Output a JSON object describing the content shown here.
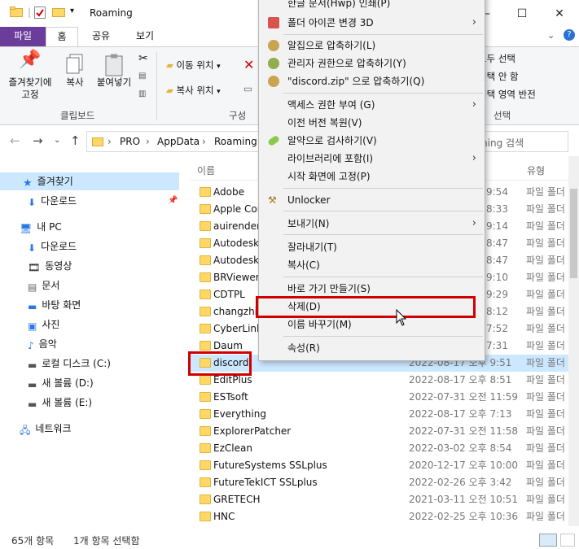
{
  "window": {
    "title": "Roaming",
    "minimize": "—",
    "maximize": "☐",
    "close": "✕"
  },
  "ribbon_tabs": [
    {
      "label": "파일"
    },
    {
      "label": "홈"
    },
    {
      "label": "공유"
    },
    {
      "label": "보기"
    }
  ],
  "ribbon": {
    "pin_label_1": "즐겨찾기에",
    "pin_label_2": "고정",
    "copy_label": "복사",
    "paste_label": "붙여넣기",
    "clipboard_group": "클립보드",
    "move_to": "이동 위치",
    "copy_to": "복사 위치",
    "organize_group": "구성",
    "select_all": "모두 선택",
    "select_none": "선택 안 함",
    "invert_select": "선택 영역 반전",
    "select_group": "선택"
  },
  "address": {
    "crumbs": [
      "PRO",
      "AppData",
      "Roaming"
    ],
    "search_placeholder": "ming 검색"
  },
  "nav": {
    "quick_access": "즐겨찾기",
    "downloads_pinned": "다운로드",
    "this_pc": "내 PC",
    "downloads": "다운로드",
    "videos": "동영상",
    "documents": "문서",
    "desktop": "바탕 화면",
    "pictures": "사진",
    "music": "음악",
    "local_disk": "로컬 디스크 (C:)",
    "volume_d": "새 볼륨 (D:)",
    "volume_e": "새 볼륨 (E:)",
    "network": "네트워크"
  },
  "columns": {
    "name": "이름",
    "type": "유형"
  },
  "files": [
    {
      "name": "Adobe",
      "date": "9:54",
      "type": "파일 폴더"
    },
    {
      "name": "Apple Con",
      "date": "8:33",
      "type": "파일 폴더"
    },
    {
      "name": "auirender",
      "date": "9:14",
      "type": "파일 폴더"
    },
    {
      "name": "Autodesk",
      "date": "8:47",
      "type": "파일 폴더"
    },
    {
      "name": "Autodesk",
      "date": "8:47",
      "type": "파일 폴더"
    },
    {
      "name": "BRViewer_",
      "date": "9:10",
      "type": "파일 폴더"
    },
    {
      "name": "CDTPL",
      "date": "9:29",
      "type": "파일 폴더"
    },
    {
      "name": "changzhi",
      "date": "8:12",
      "type": "파일 폴더"
    },
    {
      "name": "CyberLink",
      "date": "7:52",
      "type": "파일 폴더"
    },
    {
      "name": "Daum",
      "date": "7:31",
      "type": "파일 폴더"
    },
    {
      "name": "discord",
      "date": "2022-08-17 오후 9:51",
      "type": "파일 폴더"
    },
    {
      "name": "EditPlus",
      "date": "2022-08-17 오후 8:51",
      "type": "파일 폴더"
    },
    {
      "name": "ESTsoft",
      "date": "2022-07-31 오전 11:59",
      "type": "파일 폴더"
    },
    {
      "name": "Everything",
      "date": "2022-08-17 오후 7:13",
      "type": "파일 폴더"
    },
    {
      "name": "ExplorerPatcher",
      "date": "2022-07-31 오전 11:58",
      "type": "파일 폴더"
    },
    {
      "name": "EzClean",
      "date": "2022-03-02 오후 8:54",
      "type": "파일 폴더"
    },
    {
      "name": "FutureSystems SSLplus",
      "date": "2020-12-17 오후 10:00",
      "type": "파일 폴더"
    },
    {
      "name": "FutureTekICT SSLplus",
      "date": "2022-02-26 오후 3:42",
      "type": "파일 폴더"
    },
    {
      "name": "GRETECH",
      "date": "2021-03-11 오전 10:51",
      "type": "파일 폴더"
    },
    {
      "name": "HNC",
      "date": "2022-02-25 오후 10:36",
      "type": "파일 폴더"
    }
  ],
  "context_menu": [
    {
      "label": "한글 문서(Hwp) 인쇄(P)"
    },
    {
      "label": "폴더 아이콘 변경 3D"
    },
    {
      "label": "알집으로 압축하기(L)"
    },
    {
      "label": "관리자 권한으로 압축하기(Y)"
    },
    {
      "label": "\"discord.zip\" 으로 압축하기(Q)"
    },
    {
      "label": "액세스 권한 부여 (G)"
    },
    {
      "label": "이전 버전 복원(V)"
    },
    {
      "label": "알약으로 검사하기(V)"
    },
    {
      "label": "라이브러리에 포함(I)"
    },
    {
      "label": "시작 화면에 고정(P)"
    },
    {
      "label": "Unlocker"
    },
    {
      "label": "보내기(N)"
    },
    {
      "label": "잘라내기(T)"
    },
    {
      "label": "복사(C)"
    },
    {
      "label": "바로 가기 만들기(S)"
    },
    {
      "label": "삭제(D)"
    },
    {
      "label": "이름 바꾸기(M)"
    },
    {
      "label": "속성(R)"
    }
  ],
  "status": {
    "count": "65개 항목",
    "selected": "1개 항목 선택함"
  },
  "colors": {
    "highlight": "#d10000",
    "selection": "#cce8ff",
    "file_tab": "#6a3d9a"
  }
}
